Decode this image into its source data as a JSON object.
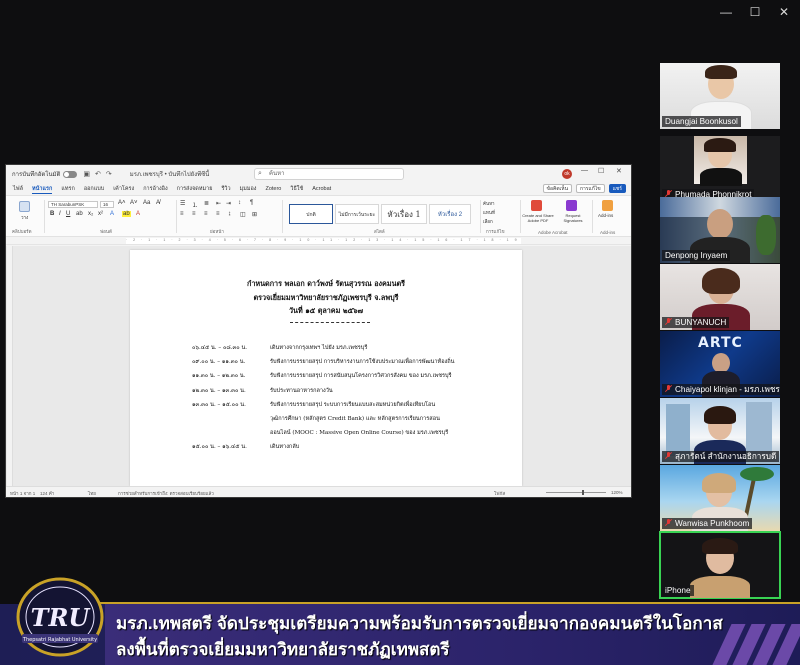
{
  "window_controls": {
    "minimize": "—",
    "maximize": "☐",
    "close": "✕"
  },
  "word": {
    "autosave_label": "การบันทึกอัตโนมัติ",
    "doc_name": "มรภ.เพชรบุรี • บันทึกไปยังพีซีนี้",
    "search_placeholder": "ค้นหา",
    "user_initials": "ok",
    "menu": [
      "ไฟล์",
      "หน้าแรก",
      "แทรก",
      "ออกแบบ",
      "เค้าโครง",
      "การอ้างอิง",
      "การส่งจดหมาย",
      "รีวิว",
      "มุมมอง",
      "Zotero",
      "วิธีใช้",
      "Acrobat"
    ],
    "menu_active": "หน้าแรก",
    "comment_btn": "ข้อคิดเห็น",
    "edit_btn": "การแก้ไข",
    "share_btn": "แชร์",
    "ribbon": {
      "clipboard": "คลิปบอร์ด",
      "paste": "วาง",
      "font_name": "TH SarabunPSK",
      "font_size": "16",
      "font_label": "ฟอนต์",
      "paragraph_label": "ย่อหน้า",
      "styles_label": "สไตล์",
      "style_normal": "ปกติ",
      "style_nospace": "ไม่มีการเว้นระยะ",
      "style_h1": "หัวเรื่อง 1",
      "style_h2": "หัวเรื่อง 2",
      "editing_label": "การแก้ไข",
      "find": "ค้นหา",
      "replace": "แทนที่",
      "select": "เลือก",
      "acrobat_label": "Adobe Acrobat",
      "create_pdf": "Create and Share Adobe PDF",
      "request_sig": "Request Signatures",
      "addins_label": "Add-ins",
      "addins": "Add-ins"
    },
    "document": {
      "header1": "กำหนดการ พลเอก ดาว์พงษ์  รัตนสุวรรณ องคมนตรี",
      "header2": "ตรวจเยี่ยมมหาวิทยาลัยราชภัฏเพชรบุรี จ.ลพบุรี",
      "header3": "วันที่ ๑๕ ตุลาคม ๒๕๖๗",
      "schedule": [
        {
          "time": "๐๖.๔๕ น. – ๐๘.๓๐ น.",
          "text": "เดินทางจากกรุงเทพฯ ไปยัง มรภ.เพชรบุรี"
        },
        {
          "time": "๐๙.๐๐ น. – ๑๑.๓๐ น.",
          "text": "รับฟังการบรรยายสรุป การบริหารงานการใช้งบประมาณเพื่อการพัฒนาท้องถิ่น"
        },
        {
          "time": "๑๑.๓๐ น. – ๑๒.๓๐ น.",
          "text": "รับฟังการบรรยายสรุป การสนับสนุนโครงการวิศวกรสังคม ของ มรภ.เพชรบุรี"
        },
        {
          "time": "๑๒.๓๐ น. – ๑๓.๓๐ น.",
          "text": "รับประทานอาหารกลางวัน"
        },
        {
          "time": "๑๓.๓๐ น. – ๑๕.๐๐ น.",
          "text": "รับฟังการบรรยายสรุป ระบบการเรียนแบบสะสมหน่วยกิตเพื่อเทียบโอน"
        },
        {
          "time": "",
          "text": "วุฒิการศึกษา (หลักสูตร Credit Bank) และ หลักสูตรการเรียนการสอน"
        },
        {
          "time": "",
          "text": "ออนไลน์ (MOOC : Massive Open Online Course) ของ มรภ.เพชรบุรี"
        },
        {
          "time": "๑๕.๐๐ น. – ๑๖.๔๕ น.",
          "text": "เดินทางกลับ"
        }
      ]
    },
    "status": {
      "page": "หน้า 1 จาก 1",
      "words": "124 คำ",
      "lang": "ไทย",
      "access": "การช่วยสำหรับการเข้าถึง: ตรวจสอบเรียบร้อยแล้ว",
      "focus": "โฟกัส",
      "zoom": "120%"
    }
  },
  "participants": [
    {
      "name": "Duangjai Boonkusol",
      "muted": false,
      "active": false
    },
    {
      "name": "Phumada Phonnikrot",
      "muted": true,
      "active": false
    },
    {
      "name": "Denpong Inyaem",
      "muted": false,
      "active": false
    },
    {
      "name": "BUNYANUCH",
      "muted": true,
      "active": false
    },
    {
      "name": "Chaiyapol klinjan - มรภ.เพชรบุรี",
      "muted": true,
      "active": false,
      "logo_text": "ARTC"
    },
    {
      "name": "สุภารัตน์  สำนักงานอธิการบดี",
      "muted": true,
      "active": false
    },
    {
      "name": "Wanwisa Punkhoom",
      "muted": true,
      "active": false
    },
    {
      "name": "iPhone",
      "muted": false,
      "active": true
    }
  ],
  "banner": {
    "logo_text": "TRU",
    "logo_sub": "Thepsatri Rajabhat University",
    "line1": "มรภ.เทพสตรี  จัดประชุมเตรียมความพร้อมรับการตรวจเยี่ยมจากองคมนตรีในโอกาส",
    "line2": "ลงพื้นที่ตรวจเยี่ยมมหาวิทยาลัยราชภัฏเทพสตรี"
  },
  "colors": {
    "accent_word": "#185abd",
    "active_speaker": "#39d353",
    "mute_red": "#e53935",
    "banner_gold": "#c9a227"
  }
}
